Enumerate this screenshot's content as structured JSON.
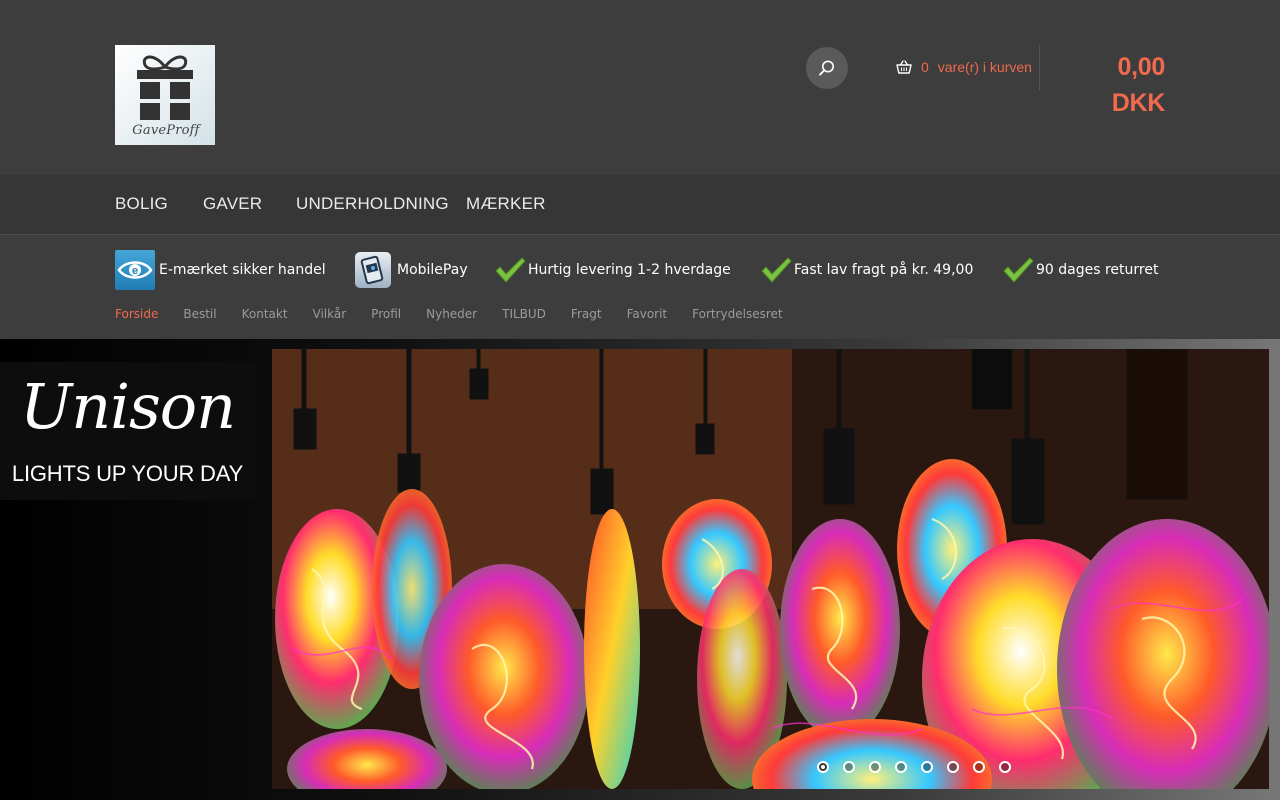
{
  "header": {
    "logo_text": "GaveProff",
    "cart": {
      "count": "0",
      "label": "vare(r) i kurven",
      "total": "0,00 DKK"
    },
    "accent_color": "#f06a4e"
  },
  "main_nav": {
    "items": [
      {
        "label": "BOLIG"
      },
      {
        "label": "GAVER"
      },
      {
        "label": "UNDERHOLDNING"
      },
      {
        "label": "MÆRKER"
      }
    ]
  },
  "trust_bar": {
    "items": [
      {
        "icon": "e-maerket-icon",
        "label": "E-mærket sikker handel"
      },
      {
        "icon": "mobilepay-icon",
        "label": "MobilePay"
      },
      {
        "icon": "checkmark-icon",
        "label": "Hurtig levering 1-2 hverdage"
      },
      {
        "icon": "checkmark-icon",
        "label": "Fast lav fragt på kr. 49,00"
      },
      {
        "icon": "checkmark-icon",
        "label": "90 dages returret"
      }
    ]
  },
  "sub_nav": {
    "items": [
      {
        "label": "Forside",
        "active": true
      },
      {
        "label": "Bestil"
      },
      {
        "label": "Kontakt"
      },
      {
        "label": "Vilkår"
      },
      {
        "label": "Profil"
      },
      {
        "label": "Nyheder"
      },
      {
        "label": "TILBUD"
      },
      {
        "label": "Fragt"
      },
      {
        "label": "Favorit"
      },
      {
        "label": "Fortrydelsesret"
      }
    ]
  },
  "hero": {
    "brand_name": "Unison",
    "brand_tagline": "LIGHTS UP YOUR DAY",
    "slider": {
      "total_slides": 8,
      "active_slide": 1
    }
  }
}
